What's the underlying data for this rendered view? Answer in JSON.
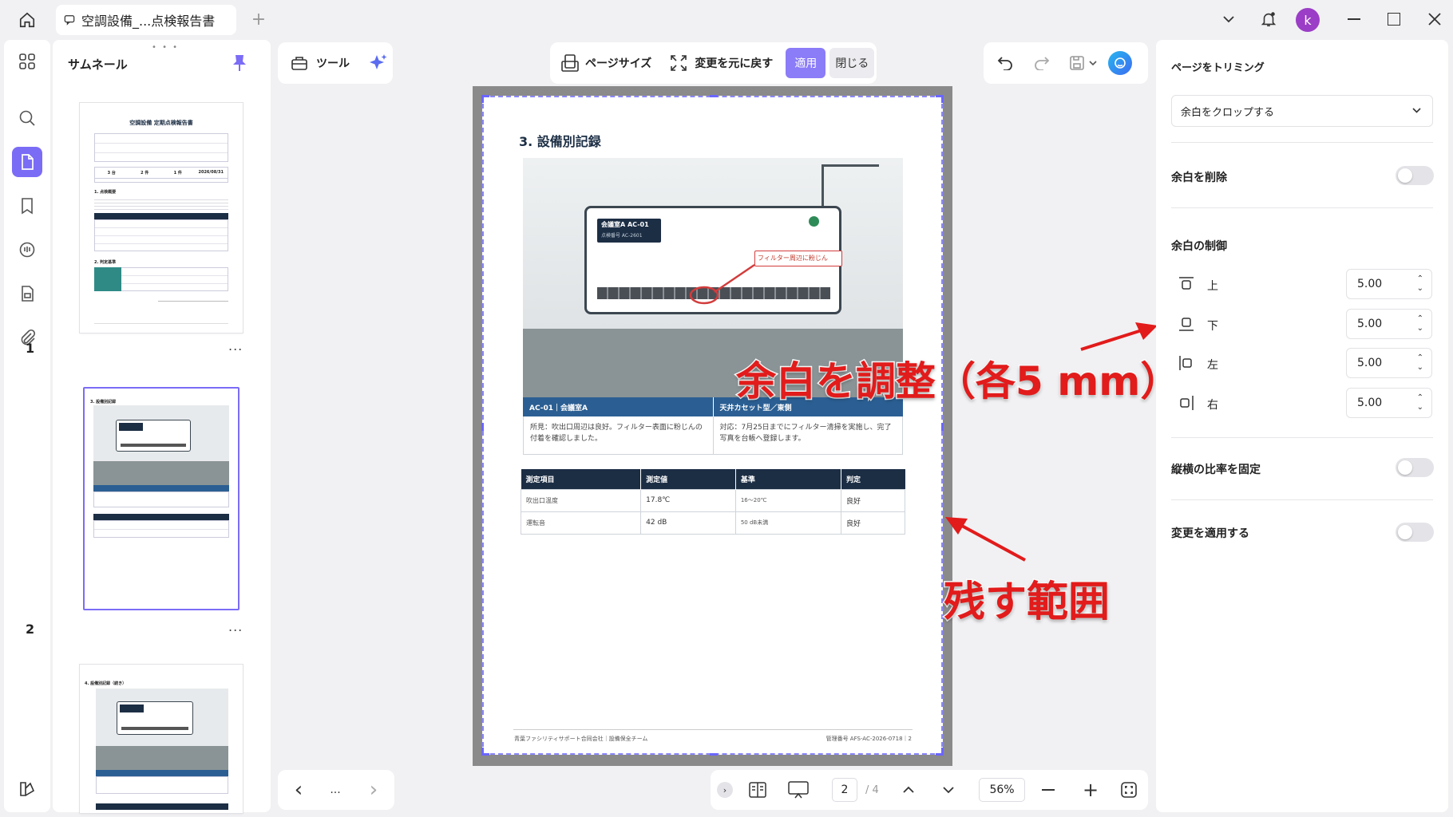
{
  "tab": {
    "title": "空調設備_...点検報告書"
  },
  "user": {
    "initial": "k"
  },
  "thumbnails": {
    "title": "サムネール",
    "pages": [
      {
        "num": "1",
        "doc_title": "空調設備 定期点検報告書",
        "stats": [
          "3 台",
          "2 件",
          "1 件",
          "2026/08/31"
        ],
        "section1": "1. 点検概要",
        "section2": "2. 判定基準"
      },
      {
        "num": "2",
        "section": "3. 設備別記録"
      },
      {
        "num": "",
        "section": "4. 設備別記録（続き）"
      }
    ],
    "more": "..."
  },
  "toolbar": {
    "tools_label": "ツール",
    "page_size": "ページサイズ",
    "reset": "変更を元に戻す",
    "apply": "適用",
    "close": "閉じる"
  },
  "document": {
    "heading": "3.  設備別記録",
    "unit_name": "会議室A AC-01",
    "unit_sub": "点検番号 AC-2601",
    "callout": "フィルター周辺に粉じん",
    "card_title_left": "AC-01｜会議室A",
    "card_title_right": "天井カセット型／東側",
    "card_text_left": "所見：吹出口周辺は良好。フィルター表面に粉じんの付着を確認しました。",
    "card_text_right": "対応：7月25日までにフィルター清掃を実施し、完了写真を台帳へ登録します。",
    "table": {
      "headers": [
        "測定項目",
        "測定値",
        "基準",
        "判定"
      ],
      "rows": [
        [
          "吹出口温度",
          "17.8℃",
          "16〜20℃",
          "良好"
        ],
        [
          "運転音",
          "42 dB",
          "50 dB未満",
          "良好"
        ]
      ]
    },
    "footer_left": "青葉ファシリティサポート合同会社｜設備保全チーム",
    "footer_right": "管理番号 AFS-AC-2026-0718｜2"
  },
  "annotations": {
    "adjust": "余白を調整（各5 mm）",
    "keep": "残す範囲"
  },
  "bottom": {
    "prev": "‹",
    "more": "...",
    "next": "›",
    "page_current": "2",
    "page_total": "/ 4",
    "zoom": "56%"
  },
  "right_panel": {
    "title": "ページをトリミング",
    "dropdown_value": "余白をクロップする",
    "remove_margin": "余白を削除",
    "margin_control": "余白の制御",
    "margins": [
      {
        "label": "上",
        "value": "5.00"
      },
      {
        "label": "下",
        "value": "5.00"
      },
      {
        "label": "左",
        "value": "5.00"
      },
      {
        "label": "右",
        "value": "5.00"
      }
    ],
    "lock_ratio": "縦横の比率を固定",
    "apply_changes": "変更を適用する"
  },
  "colors": {
    "accent": "#7b6cf6",
    "highlight": "#e21b1b",
    "doc_blue": "#2b5f93",
    "doc_navy": "#1c2e44"
  }
}
